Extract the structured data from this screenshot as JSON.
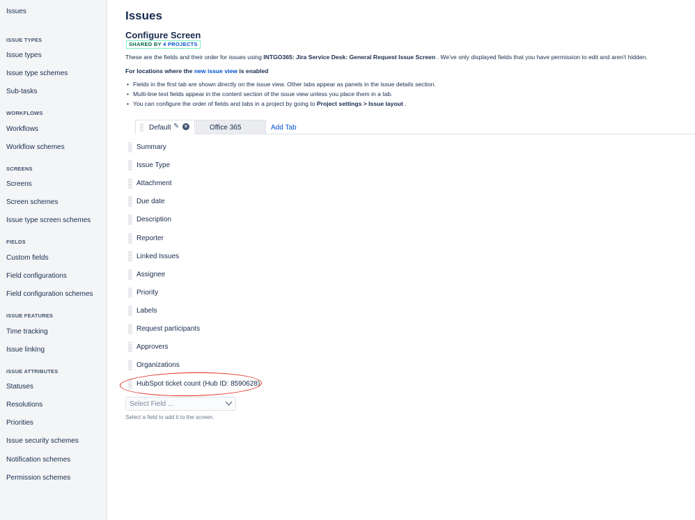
{
  "sidebar": {
    "top_link": "Issues",
    "sections": [
      {
        "heading": "ISSUE TYPES",
        "items": [
          "Issue types",
          "Issue type schemes",
          "Sub-tasks"
        ]
      },
      {
        "heading": "WORKFLOWS",
        "items": [
          "Workflows",
          "Workflow schemes"
        ]
      },
      {
        "heading": "SCREENS",
        "items": [
          "Screens",
          "Screen schemes",
          "Issue type screen schemes"
        ]
      },
      {
        "heading": "FIELDS",
        "items": [
          "Custom fields",
          "Field configurations",
          "Field configuration schemes"
        ]
      },
      {
        "heading": "ISSUE FEATURES",
        "items": [
          "Time tracking",
          "Issue linking"
        ]
      },
      {
        "heading": "ISSUE ATTRIBUTES",
        "items": [
          "Statuses",
          "Resolutions",
          "Priorities",
          "Issue security schemes",
          "Notification schemes",
          "Permission schemes"
        ]
      }
    ]
  },
  "main": {
    "page_title": "Issues",
    "screen_title": "Configure Screen",
    "shared_badge": {
      "prefix": "SHARED BY ",
      "link": "4 PROJECTS"
    },
    "description": {
      "before": "These are the fields and their order for issues using ",
      "screen_name": "INTGO365: Jira Service Desk: General Request Issue Screen",
      "after": " . We've only displayed fields that you have permission to edit and aren't hidden."
    },
    "locations_heading": {
      "before": "For locations where the ",
      "link": "new issue view",
      "after": " is enabled"
    },
    "bullets": [
      "Fields in the first tab are shown directly on the issue view. Other tabs appear as panels in the issue details section.",
      "Multi-line text fields appear in the content section of the issue view unless you place them in a tab."
    ],
    "bullet3": {
      "before": "You can configure the order of fields and tabs in a project by going to ",
      "bold": "Project settings > Issue layout",
      "after": " ."
    },
    "tabs": [
      {
        "label": "Default",
        "active": true
      },
      {
        "label": "Office 365",
        "active": false
      }
    ],
    "add_tab_label": "Add Tab",
    "fields": [
      "Summary",
      "Issue Type",
      "Attachment",
      "Due date",
      "Description",
      "Reporter",
      "Linked Issues",
      "Assignee",
      "Priority",
      "Labels",
      "Request participants",
      "Approvers",
      "Organizations",
      "HubSpot ticket count (Hub ID: 8590628)"
    ],
    "select_field": {
      "placeholder": "Select Field ...",
      "help": "Select a field to add it to the screen."
    },
    "annotation_color": "#e0281c"
  }
}
